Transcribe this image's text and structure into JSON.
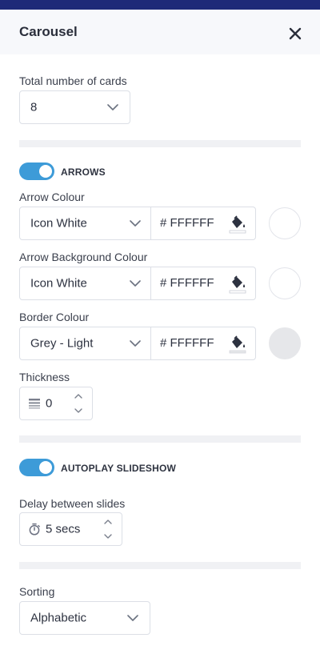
{
  "panel": {
    "title": "Carousel",
    "accent_color": "#1e2a78",
    "toggle_color": "#3d9bd8"
  },
  "cards": {
    "label": "Total number of cards",
    "value": "8"
  },
  "arrows": {
    "toggle_label": "ARROWS",
    "enabled": true,
    "arrow_colour": {
      "label": "Arrow Colour",
      "selected": "Icon White",
      "hex": "# FFFFFF",
      "swatch": "#ffffff"
    },
    "arrow_background_colour": {
      "label": "Arrow Background Colour",
      "selected": "Icon White",
      "hex": "# FFFFFF",
      "swatch": "#ffffff"
    },
    "border_colour": {
      "label": "Border Colour",
      "selected": "Grey - Light",
      "hex": "# FFFFFF",
      "swatch": "#e6e7ea"
    },
    "thickness": {
      "label": "Thickness",
      "value": "0"
    }
  },
  "autoplay": {
    "toggle_label": "AUTOPLAY SLIDESHOW",
    "enabled": true,
    "delay": {
      "label": "Delay between slides",
      "value": "5 secs"
    }
  },
  "sorting": {
    "label": "Sorting",
    "selected": "Alphabetic"
  },
  "icons": {
    "close": "close-icon",
    "chevron": "chevron-down-icon",
    "fill": "paint-bucket-icon",
    "thickness": "line-weight-icon",
    "timer": "stopwatch-icon",
    "stepper": "up-down-arrows-icon"
  }
}
